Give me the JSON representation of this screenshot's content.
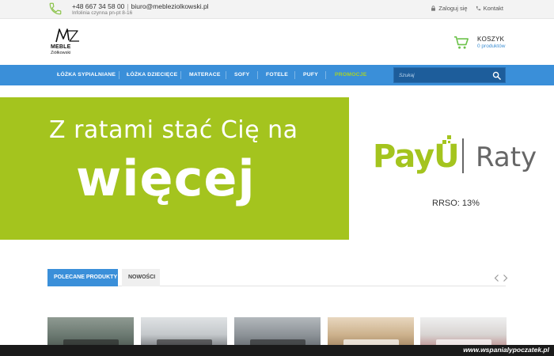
{
  "topbar": {
    "phone": "+48 667 34 58 00",
    "separator": "|",
    "email": "biuro@mebleziolkowski.pl",
    "hours": "Infolinia czynna pn-pt 8-16",
    "login": "Zaloguj się",
    "contact": "Kontakt"
  },
  "logo": {
    "line1": "MEBLE",
    "line2": "Ziółkowski"
  },
  "cart": {
    "title": "KOSZYK",
    "count": "0 produktów"
  },
  "nav": {
    "items": [
      {
        "label": "ŁÓŻKA SYPIALNIANE"
      },
      {
        "label": "ŁÓŻKA DZIECIĘCE"
      },
      {
        "label": "MATERACE"
      },
      {
        "label": "SOFY"
      },
      {
        "label": "FOTELE"
      },
      {
        "label": "PUFY"
      },
      {
        "label": "PROMOCJE"
      }
    ],
    "search_placeholder": "Szukaj"
  },
  "banner": {
    "line1": "Z ratami stać Cię na",
    "line2": "więcej",
    "payu": "PayU",
    "raty": "Raty",
    "rrso": "RRSO: 13%"
  },
  "tabs": [
    {
      "label": "POLECANE PRODUKTY"
    },
    {
      "label": "NOWOŚCI"
    }
  ],
  "watermark": "www.wspanialypoczatek.pl",
  "colors": {
    "accent_blue": "#3a8fd9",
    "promo_green": "#a6d12a",
    "banner_green": "#a4c41e"
  }
}
